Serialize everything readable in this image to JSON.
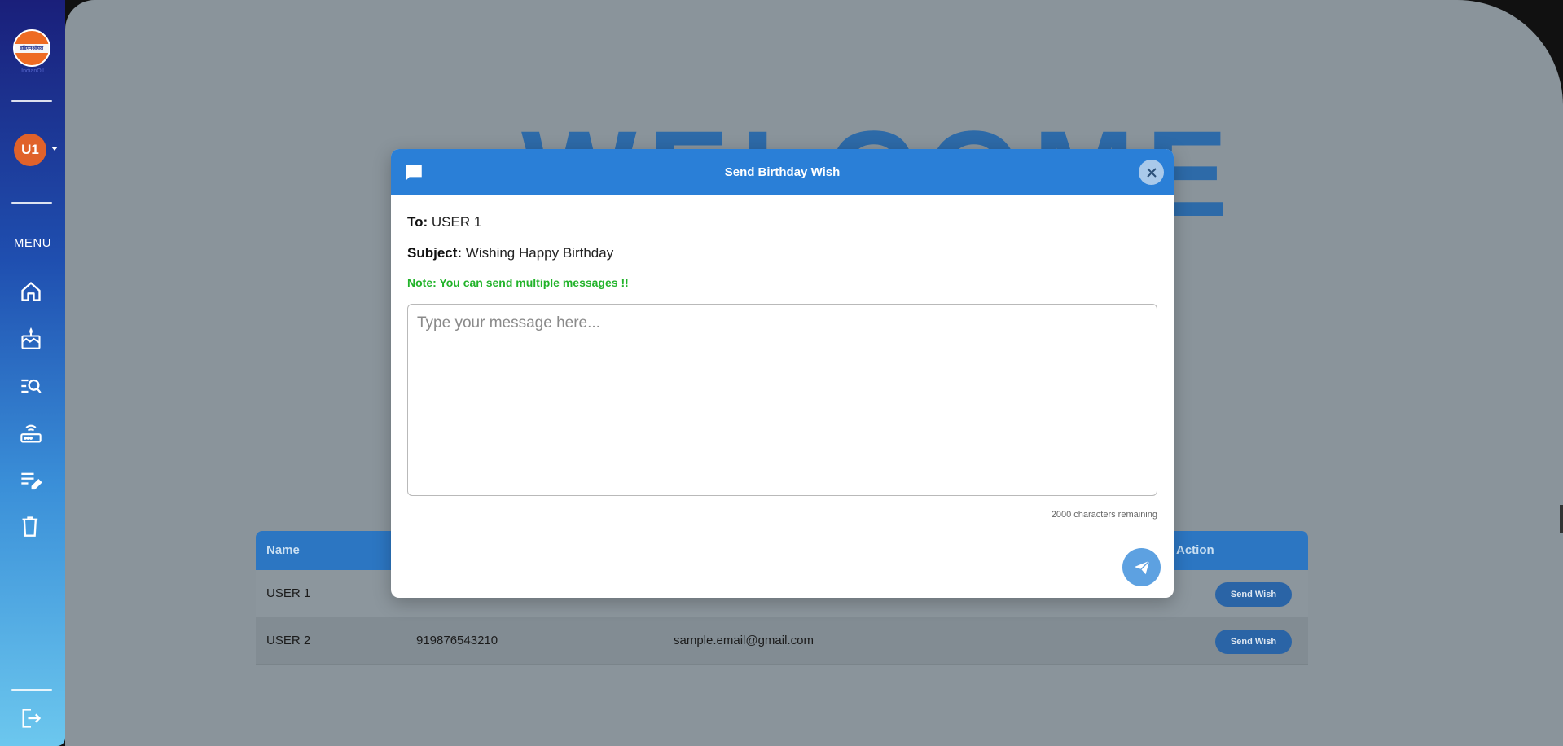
{
  "sidebar": {
    "logo_text": "इंडियनऑयल",
    "logo_sub": "IndianOil",
    "avatar_initials": "U1",
    "menu_label": "MENU",
    "nav_items": [
      "home-icon",
      "birthday-cake-icon",
      "search-list-icon",
      "router-icon",
      "edit-list-icon",
      "trash-icon"
    ],
    "logout_icon": "logout-icon"
  },
  "background": {
    "welcome_text": "WELCOME",
    "table": {
      "headers": [
        "Name",
        "",
        "",
        "Action"
      ],
      "rows": [
        {
          "name": "USER 1",
          "phone": "",
          "email": "",
          "action": "Send Wish"
        },
        {
          "name": "USER 2",
          "phone": "919876543210",
          "email": "sample.email@gmail.com",
          "action": "Send Wish"
        }
      ]
    }
  },
  "modal": {
    "title": "Send Birthday Wish",
    "to_label": "To:",
    "to_value": "USER 1",
    "subject_label": "Subject:",
    "subject_value": "Wishing Happy Birthday",
    "note": "Note: You can send multiple messages !!",
    "message_placeholder": "Type your message here...",
    "message_value": "",
    "chars_remaining": "2000 characters remaining"
  },
  "colors": {
    "accent": "#2a7fd7",
    "note_green": "#22b32a",
    "avatar": "#e0622a"
  }
}
